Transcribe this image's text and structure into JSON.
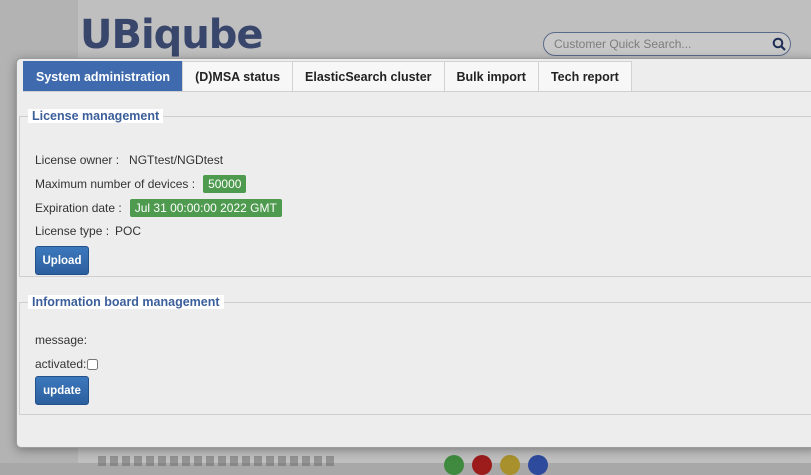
{
  "background": {
    "logo_text": "UBiqube",
    "search_placeholder": "Customer Quick Search...",
    "search_icon": "magnifier-icon",
    "dot_colors": [
      "#3f8a3f",
      "#9c1c1c",
      "#a8912c",
      "#2d4a9c"
    ]
  },
  "tabs": [
    {
      "label": "System administration",
      "active": true
    },
    {
      "label": "(D)MSA status",
      "active": false
    },
    {
      "label": "ElasticSearch cluster",
      "active": false
    },
    {
      "label": "Bulk import",
      "active": false
    },
    {
      "label": "Tech report",
      "active": false
    }
  ],
  "license": {
    "title": "License management",
    "owner_label": "License owner :",
    "owner_value": "NGTtest/NGDtest",
    "max_devices_label": "Maximum number of devices :",
    "max_devices_value": "50000",
    "expiration_label": "Expiration date :",
    "expiration_value": "Jul 31 00:00:00 2022 GMT",
    "type_label": "License type :",
    "type_value": "POC",
    "upload_button": "Upload"
  },
  "info_board": {
    "title": "Information board management",
    "message_label": "message:",
    "activated_label": "activated:",
    "activated_checked": false,
    "update_button": "update"
  },
  "colors": {
    "tab_active": "#3f6bae",
    "badge_green": "#4e9a4e",
    "button_blue": "#2c5f9e",
    "legend_text": "#3b5f9b"
  }
}
